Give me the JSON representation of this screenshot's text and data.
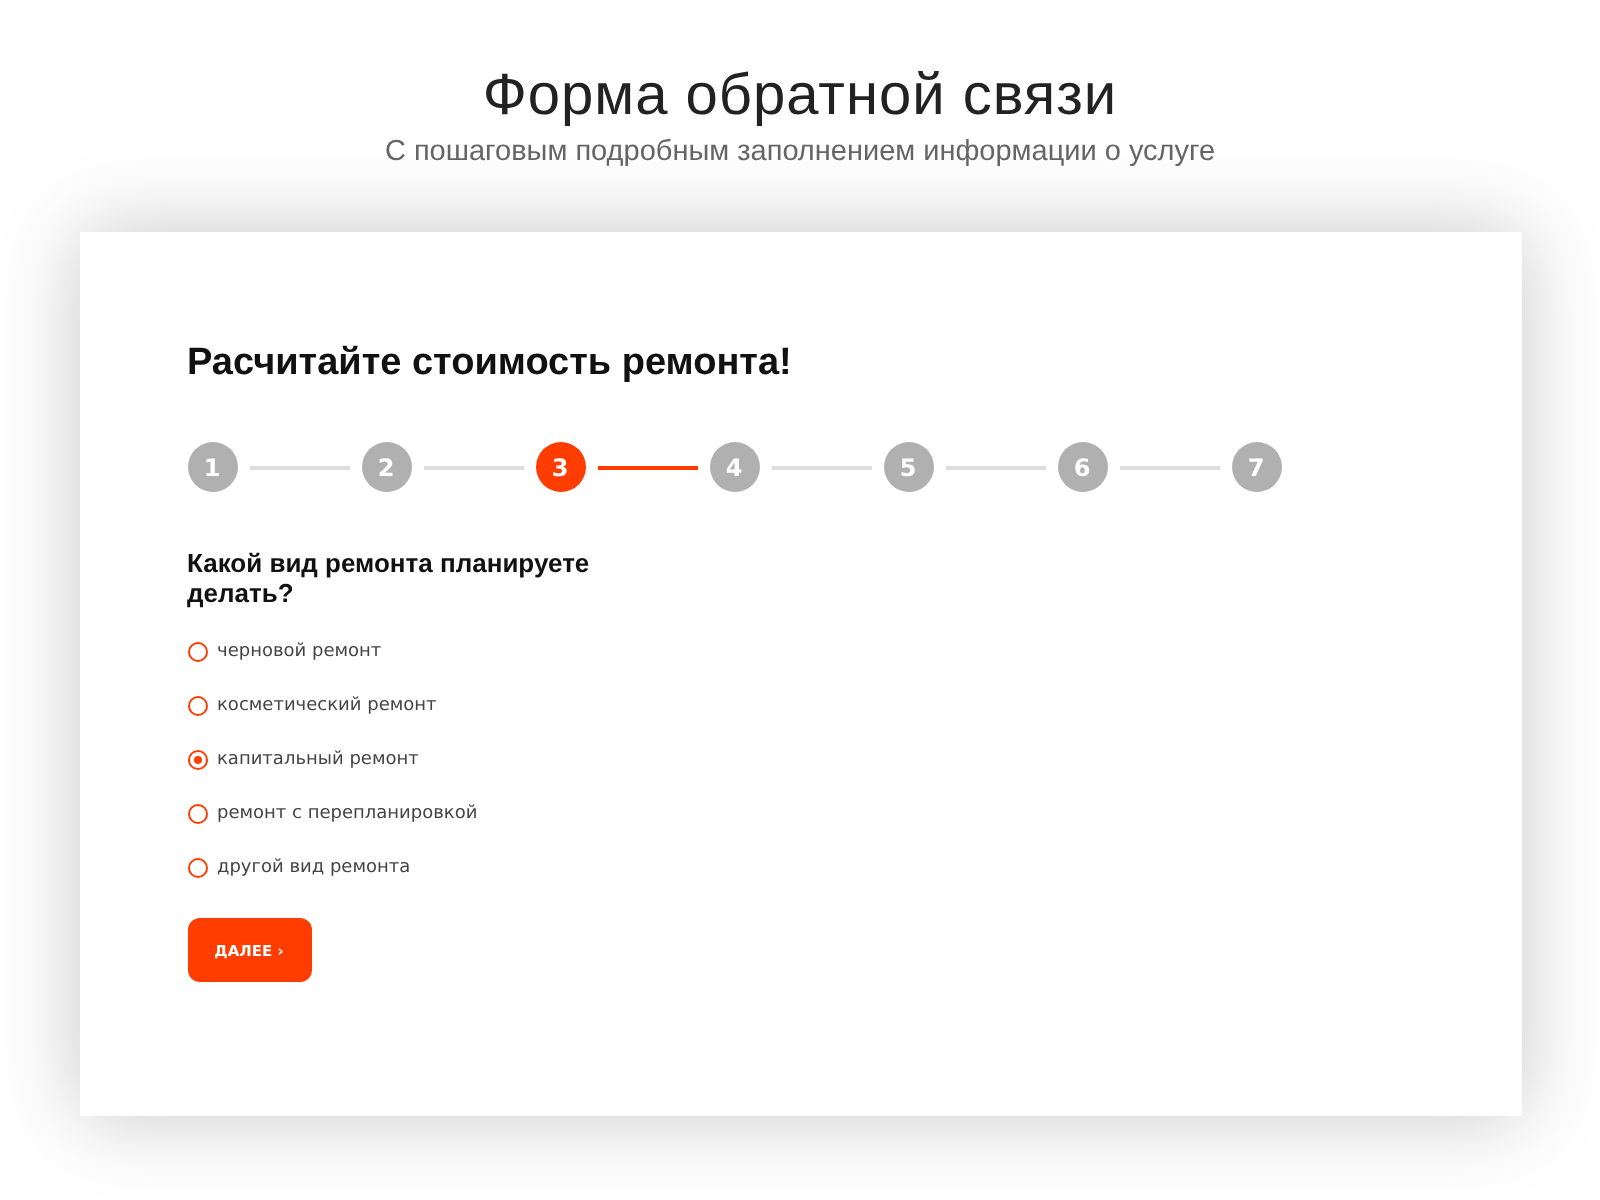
{
  "header": {
    "title": "Форма обратной связи",
    "subtitle": "С пошаговым подробным заполнением информации о услуге"
  },
  "form": {
    "heading": "Расчитайте стоимость ремонта!",
    "steps": [
      {
        "label": "1",
        "selected": false
      },
      {
        "label": "2",
        "selected": false
      },
      {
        "label": "3",
        "selected": true
      },
      {
        "label": "4",
        "selected": false
      },
      {
        "label": "5",
        "selected": false
      },
      {
        "label": "6",
        "selected": false
      },
      {
        "label": "7",
        "selected": false
      }
    ],
    "question": "Какой вид ремонта планируете делать?",
    "options": [
      {
        "label": "черновой ремонт",
        "selected": false
      },
      {
        "label": "косметический ремонт",
        "selected": false
      },
      {
        "label": "капитальный ремонт",
        "selected": true
      },
      {
        "label": "ремонт с перепланировкой",
        "selected": false
      },
      {
        "label": "другой вид ремонта",
        "selected": false
      }
    ],
    "button": "ДАЛЕЕ ›"
  }
}
